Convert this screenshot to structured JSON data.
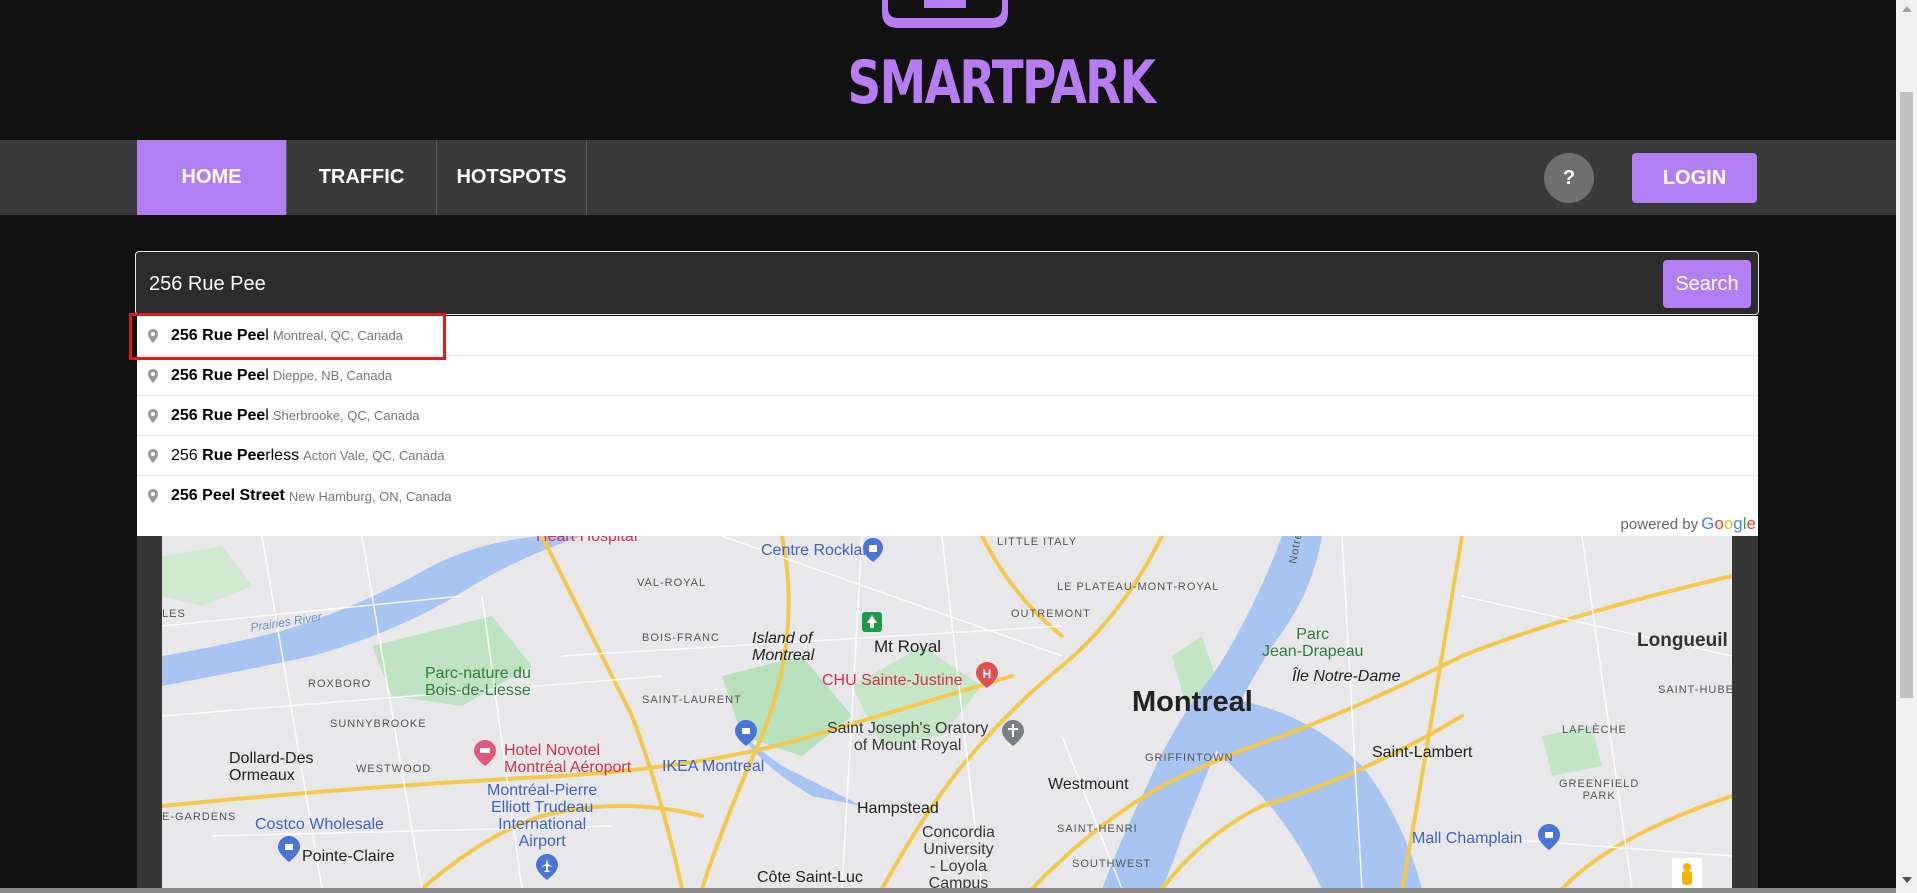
{
  "brand": {
    "name": "SMARTPARK",
    "accent": "#b27ef3"
  },
  "nav": {
    "items": [
      {
        "label": "HOME",
        "active": true
      },
      {
        "label": "TRAFFIC",
        "active": false
      },
      {
        "label": "HOTSPOTS",
        "active": false
      }
    ],
    "help_label": "?",
    "login_label": "LOGIN"
  },
  "search": {
    "value": "256 Rue Pee",
    "button_label": "Search"
  },
  "autocomplete": {
    "suggestions": [
      {
        "bold": "256 Rue Pee",
        "rest": "l",
        "secondary": "Montreal, QC, Canada"
      },
      {
        "bold": "256 Rue Pee",
        "rest": "l",
        "secondary": "Dieppe, NB, Canada"
      },
      {
        "bold": "256 Rue Pee",
        "rest": "l",
        "secondary": "Sherbrooke, QC, Canada"
      },
      {
        "pre": "256 ",
        "bold": "Rue Pee",
        "rest": "rless",
        "secondary": "Acton Vale, QC, Canada"
      },
      {
        "bold": "256 Peel Street",
        "rest": "",
        "secondary": "New Hamburg, ON, Canada"
      }
    ],
    "powered_by": "powered by",
    "provider": "Google"
  },
  "map": {
    "labels": {
      "montreal": "Montreal",
      "longueuil": "Longueuil",
      "island": "Island of\nMontreal",
      "mt_royal": "Mt Royal",
      "chu": "CHU Sainte-Justine",
      "centre_rockland": "Centre Rockland",
      "heart_hospital": "Heart Hospital",
      "little_italy": "LITTLE ITALY",
      "plateau": "LE PLATEAU-MONT-ROYAL",
      "val_royal": "VAL-ROYAL",
      "bois_franc": "BOIS-FRANC",
      "outremont": "OUTREMONT",
      "parc_nature": "Parc-nature du\nBois-de-Liesse",
      "roxboro": "ROXBORO",
      "sunnybrooke": "SUNNYBROOKE",
      "saint_laurent": "SAINT-LAURENT",
      "prairies": "Prairies River",
      "oratory": "Saint Joseph's Oratory\nof Mount Royal",
      "dollard": "Dollard-Des\nOrmeaux",
      "westwood": "WESTWOOD",
      "novotel": "Hotel Novotel\nMontréal Aéroport",
      "ikea": "IKEA Montreal",
      "westmount": "Westmount",
      "griffintown": "GRIFFINTOWN",
      "parc_jd": "Parc\nJean-Drapeau",
      "ile_nd": "Île Notre-Dame",
      "saint_lambert": "Saint-Lambert",
      "lafleche": "LAFLÈCHE",
      "saint_hubert": "SAINT-HUBE",
      "greenfield": "GREENFIELD\nPARK",
      "trudeau": "Montréal-Pierre\nElliott Trudeau\nInternational\nAirport",
      "hampstead": "Hampstead",
      "concordia": "Concordia\nUniversity\n- Loyola\nCampus",
      "saint_henri": "SAINT-HENRI",
      "costco": "Costco Wholesale",
      "pointe_claire": "Pointe-Claire",
      "cote_st_luc": "Côte Saint-Luc",
      "southwest": "SOUTHWEST",
      "mall_champlain": "Mall Champlain",
      "gardens": "E-GARDENS",
      "les": "LES",
      "notre": "Notre"
    }
  }
}
